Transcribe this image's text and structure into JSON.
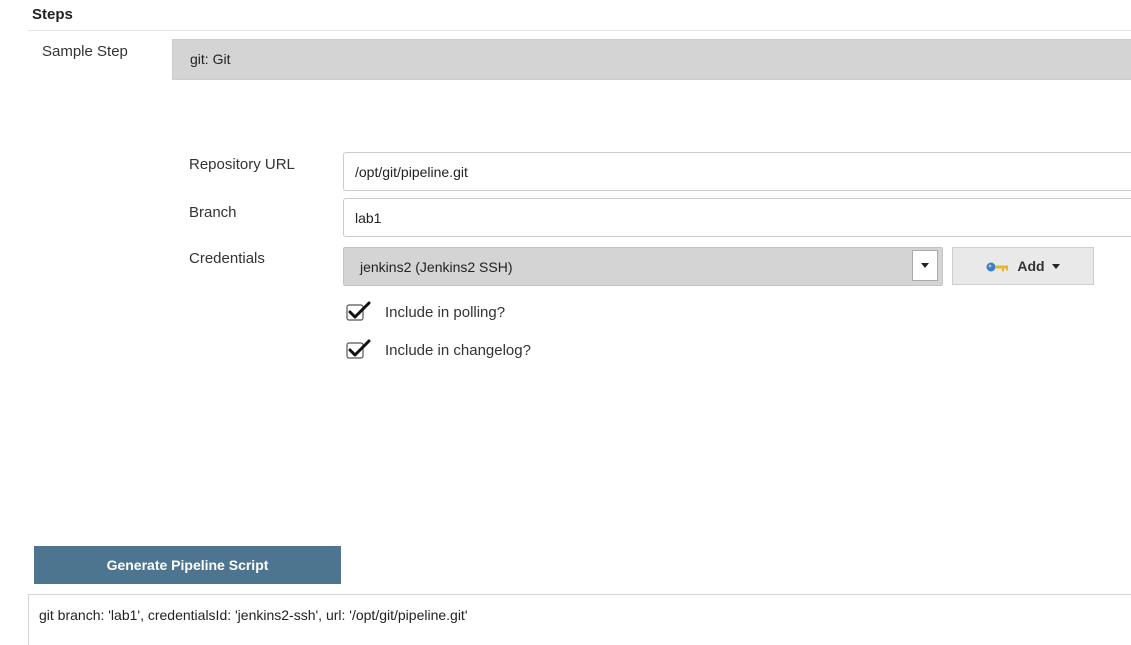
{
  "section": {
    "title": "Steps"
  },
  "sample_step": {
    "label": "Sample Step",
    "value": "git: Git"
  },
  "fields": {
    "repository_url": {
      "label": "Repository URL",
      "value": "/opt/git/pipeline.git"
    },
    "branch": {
      "label": "Branch",
      "value": "lab1"
    },
    "credentials": {
      "label": "Credentials",
      "value": "jenkins2 (Jenkins2 SSH)",
      "add_label": "Add"
    }
  },
  "options": {
    "polling": {
      "label": "Include in polling?",
      "checked": true
    },
    "changelog": {
      "label": "Include in changelog?",
      "checked": true
    }
  },
  "actions": {
    "generate_label": "Generate Pipeline Script"
  },
  "output": {
    "script": "git branch: 'lab1', credentialsId: 'jenkins2-ssh', url: '/opt/git/pipeline.git'"
  },
  "colors": {
    "generate_button": "#4d7590",
    "select_background": "#d4d4d4",
    "key_icon_blue": "#3b7fc4",
    "key_icon_yellow": "#e8b62a"
  },
  "icons": [
    "dropdown-arrow-icon",
    "key-icon",
    "caret-down-icon",
    "checkbox-checked-icon"
  ]
}
